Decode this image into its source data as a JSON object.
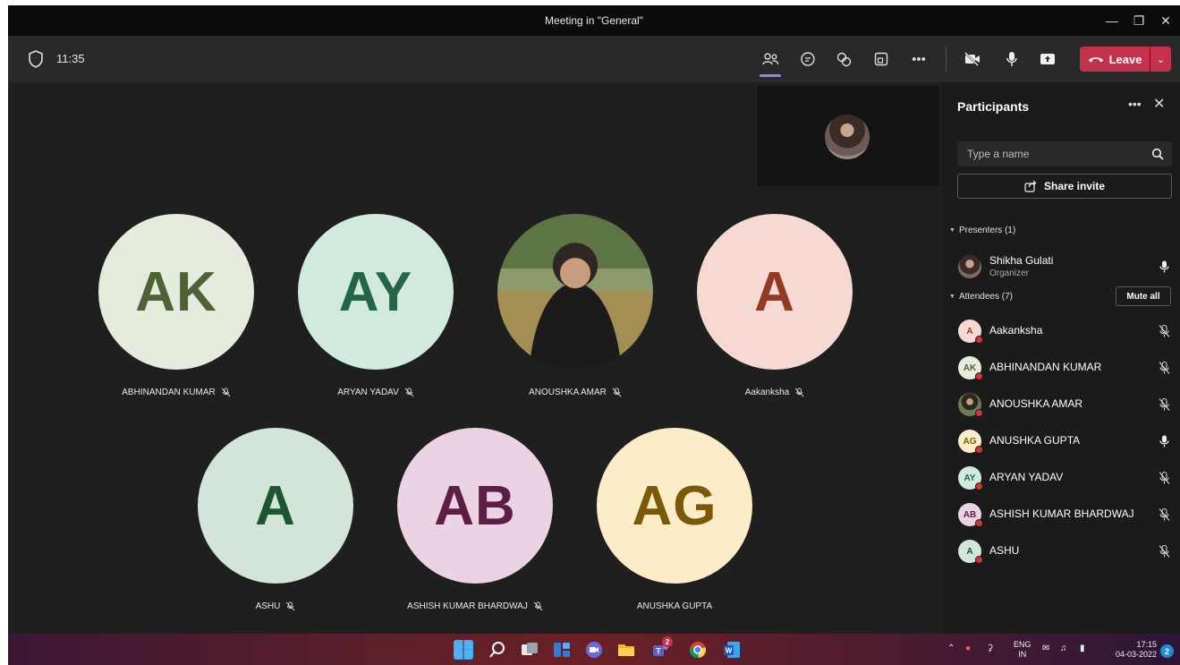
{
  "window": {
    "title": "Meeting in \"General\""
  },
  "toolbar": {
    "time": "11:35",
    "leave_label": "Leave"
  },
  "tiles": [
    {
      "initials": "AK",
      "name": "ABHINANDAN KUMAR",
      "bg": "#e5ecde",
      "fg": "#4f6137"
    },
    {
      "initials": "AY",
      "name": "ARYAN YADAV",
      "bg": "#d2e9de",
      "fg": "#226645"
    },
    {
      "initials": "",
      "name": "ANOUSHKA AMAR",
      "bg": "#6b7d4f",
      "fg": "#ffffff"
    },
    {
      "initials": "A",
      "name": "Aakanksha",
      "bg": "#f7d9d3",
      "fg": "#923a23"
    },
    {
      "initials": "A",
      "name": "ASHU",
      "bg": "#d3e5d9",
      "fg": "#1d5533"
    },
    {
      "initials": "AB",
      "name": "ASHISH KUMAR BHARDWAJ",
      "bg": "#ebd3e3",
      "fg": "#5e1d44"
    },
    {
      "initials": "AG",
      "name": "ANUSHKA GUPTA",
      "bg": "#fcecc8",
      "fg": "#7a5908"
    }
  ],
  "panel": {
    "title": "Participants",
    "search_placeholder": "Type a name",
    "share_invite": "Share invite",
    "presenters_label": "Presenters (1)",
    "attendees_label": "Attendees (7)",
    "mute_all": "Mute all",
    "presenter": {
      "name": "Shikha Gulati",
      "role": "Organizer"
    },
    "attendees": [
      {
        "initials": "A",
        "name": "Aakanksha",
        "bg": "#f7d9d3",
        "fg": "#923a23",
        "muted": true
      },
      {
        "initials": "AK",
        "name": "ABHINANDAN KUMAR",
        "bg": "#e5ecde",
        "fg": "#4f6137",
        "muted": true
      },
      {
        "initials": "",
        "name": "ANOUSHKA AMAR",
        "bg": "#6b7d4f",
        "fg": "#ffffff",
        "muted": true
      },
      {
        "initials": "AG",
        "name": "ANUSHKA GUPTA",
        "bg": "#fcecc8",
        "fg": "#7a5908",
        "muted": false
      },
      {
        "initials": "AY",
        "name": "ARYAN YADAV",
        "bg": "#d2e9de",
        "fg": "#226645",
        "muted": true
      },
      {
        "initials": "AB",
        "name": "ASHISH KUMAR BHARDWAJ",
        "bg": "#ebd3e3",
        "fg": "#5e1d44",
        "muted": true
      },
      {
        "initials": "A",
        "name": "ASHU",
        "bg": "#d3e5d9",
        "fg": "#1d5533",
        "muted": true
      }
    ]
  },
  "taskbar": {
    "teams_badge": "2",
    "lang_top": "ENG",
    "lang_bottom": "IN",
    "time": "17:15",
    "date": "04-03-2022",
    "notifications": "2"
  },
  "colors": {
    "accent": "#8c8ce6",
    "leave": "#c4314b",
    "status_dot": "#d13438"
  }
}
